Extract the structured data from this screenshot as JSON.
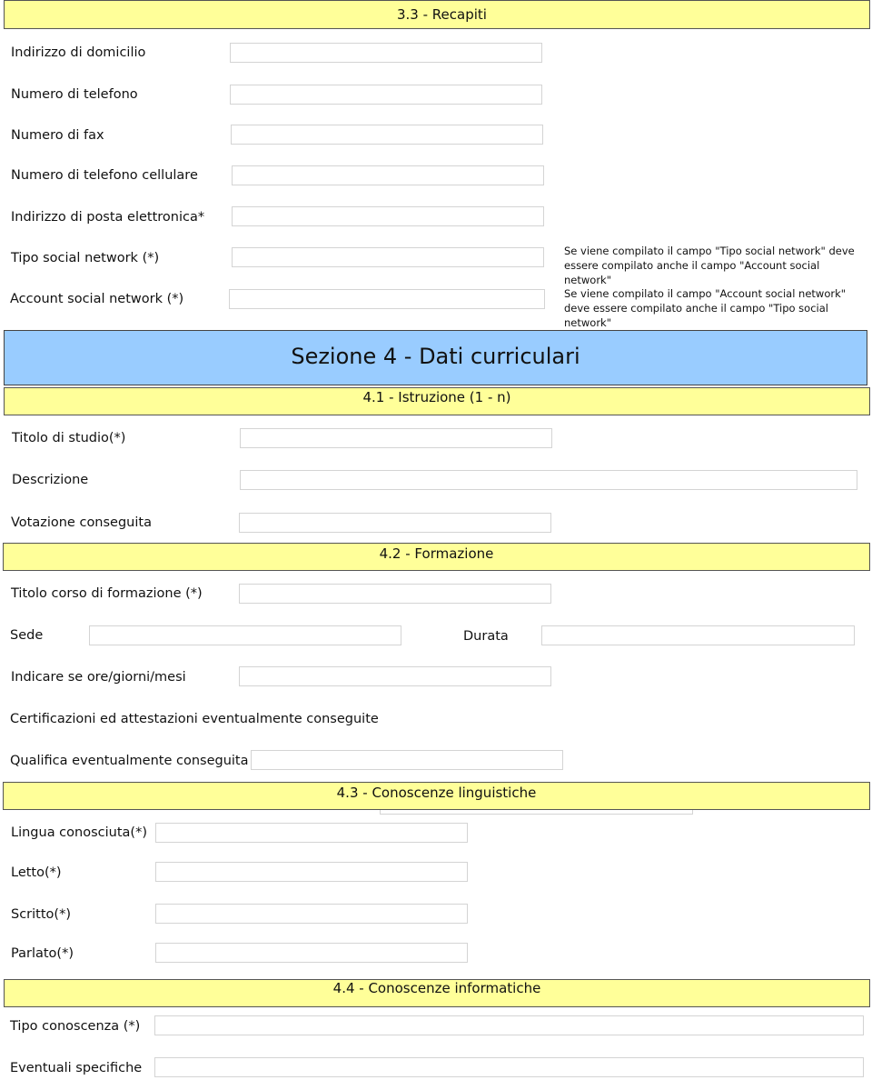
{
  "section_3_3": {
    "title": "3.3 - Recapiti",
    "fields": [
      {
        "label": "Indirizzo di domicilio",
        "value": ""
      },
      {
        "label": "Numero di telefono",
        "value": ""
      },
      {
        "label": "Numero di fax",
        "value": ""
      },
      {
        "label": "Numero di telefono cellulare",
        "value": ""
      },
      {
        "label": "Indirizzo di posta elettronica*",
        "value": ""
      },
      {
        "label": "Tipo social network (*)",
        "value": ""
      },
      {
        "label": "Account social network (*)",
        "value": ""
      }
    ],
    "notes": {
      "tipo_social": "Se viene compilato il campo \"Tipo social network\" deve essere compilato anche il campo \"Account social network\"",
      "account_social": "Se viene compilato il campo \"Account social network\" deve essere compilato anche il campo \"Tipo social network\""
    }
  },
  "section_4": {
    "title": "Sezione 4 - Dati curriculari"
  },
  "section_4_1": {
    "title": "4.1 - Istruzione (1 - n)",
    "fields": [
      {
        "label": "Titolo di studio(*)",
        "value": ""
      },
      {
        "label": "Descrizione",
        "value": ""
      },
      {
        "label": "Votazione conseguita",
        "value": ""
      }
    ]
  },
  "section_4_2": {
    "title": "4.2 - Formazione",
    "fields": {
      "titolo_corso": {
        "label": "Titolo corso di formazione (*)",
        "value": ""
      },
      "sede": {
        "label": "Sede",
        "value": ""
      },
      "durata": {
        "label": "Durata",
        "value": ""
      },
      "unita": {
        "label": "Indicare se ore/giorni/mesi",
        "value": ""
      },
      "certificazioni": {
        "label": "Certificazioni ed attestazioni eventualmente conseguite"
      },
      "qualifica": {
        "label": "Qualifica eventualmente conseguita",
        "value": ""
      }
    }
  },
  "section_4_3": {
    "title": "4.3 - Conoscenze linguistiche",
    "fields": [
      {
        "label": "Lingua conosciuta(*)",
        "value": ""
      },
      {
        "label": "Letto(*)",
        "value": ""
      },
      {
        "label": "Scritto(*)",
        "value": ""
      },
      {
        "label": "Parlato(*)",
        "value": ""
      }
    ]
  },
  "section_4_4": {
    "title": "4.4 - Conoscenze informatiche",
    "fields": [
      {
        "label": "Tipo conoscenza (*)",
        "value": ""
      },
      {
        "label": "Eventuali specifiche",
        "value": ""
      }
    ]
  },
  "colors": {
    "subsection_header": "#ffff99",
    "section_header": "#99ccff",
    "field_border": "#d4d4d4"
  }
}
